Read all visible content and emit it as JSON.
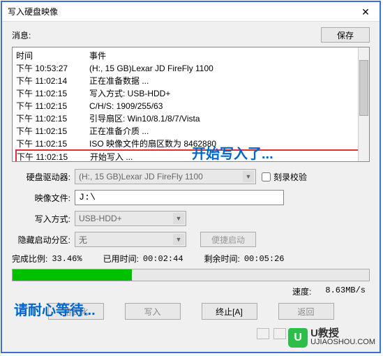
{
  "window": {
    "title": "写入硬盘映像",
    "close": "✕"
  },
  "info": {
    "label": "消息:",
    "save": "保存"
  },
  "log": {
    "header_time": "时间",
    "header_event": "事件",
    "rows": [
      {
        "time": "下午 10:53:27",
        "event": "(H:, 15 GB)Lexar   JD FireFly    1100"
      },
      {
        "time": "下午 11:02:14",
        "event": "正在准备数据 ..."
      },
      {
        "time": "下午 11:02:15",
        "event": "写入方式: USB-HDD+"
      },
      {
        "time": "下午 11:02:15",
        "event": "C/H/S: 1909/255/63"
      },
      {
        "time": "下午 11:02:15",
        "event": "引导扇区: Win10/8.1/8/7/Vista"
      },
      {
        "time": "下午 11:02:15",
        "event": "正在准备介质 ..."
      },
      {
        "time": "下午 11:02:15",
        "event": "ISO 映像文件的扇区数为 8462880"
      },
      {
        "time": "下午 11:02:15",
        "event": "开始写入 ..."
      }
    ]
  },
  "annotation1": "开始写入了...",
  "annotation2": "请耐心等待...",
  "form": {
    "drive_label": "硬盘驱动器:",
    "drive_value": "(H:, 15 GB)Lexar  JD FireFly   1100",
    "verify_label": "刻录校验",
    "image_label": "映像文件:",
    "image_value": "J:\\",
    "write_label": "写入方式:",
    "write_value": "USB-HDD+",
    "hidden_label": "隐藏启动分区:",
    "hidden_value": "无",
    "conv_btn": "便捷启动"
  },
  "stats": {
    "done_label": "完成比例:",
    "done_value": "33.46%",
    "elapsed_label": "已用时间:",
    "elapsed_value": "00:02:44",
    "remain_label": "剩余时间:",
    "remain_value": "00:05:26",
    "progress_pct": 33.46,
    "speed_label": "速度:",
    "speed_value": "8.63MB/s"
  },
  "buttons": {
    "format": "格式化",
    "write": "写入",
    "abort": "终止[A]",
    "back": "返回"
  },
  "watermark": {
    "letter": "U",
    "name": "U教授",
    "domain": "UJIAOSHOU.COM"
  }
}
